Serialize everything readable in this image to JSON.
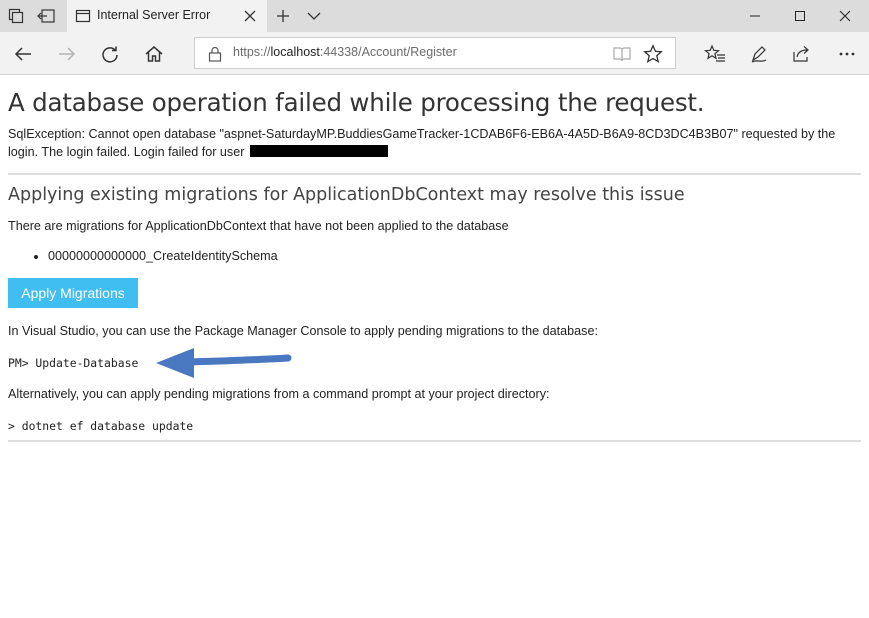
{
  "browser": {
    "tab": {
      "title": "Internal Server Error"
    },
    "address": {
      "prefix": "https://",
      "host": "localhost",
      "rest": ":44338/Account/Register"
    }
  },
  "page": {
    "title": "A database operation failed while processing the request.",
    "exception_line1": "SqlException: Cannot open database \"aspnet-SaturdayMP.BuddiesGameTracker-1CDAB6F6-EB6A-4A5D-B6A9-8CD3DC4B3B07\" requested by the",
    "exception_line2": "login. The login failed. Login failed for user",
    "subtitle": "Applying existing migrations for ApplicationDbContext may resolve this issue",
    "migrations_intro": "There are migrations for ApplicationDbContext that have not been applied to the database",
    "migrations": [
      "00000000000000_CreateIdentitySchema"
    ],
    "apply_button": "Apply Migrations",
    "vs_text": "In Visual Studio, you can use the Package Manager Console to apply pending migrations to the database:",
    "pm_command": "PM> Update-Database",
    "alt_text": "Alternatively, you can apply pending migrations from a command prompt at your project directory:",
    "cli_command": "> dotnet ef database update"
  },
  "colors": {
    "button_bg": "#41bef1",
    "arrow": "#4a78c0"
  }
}
